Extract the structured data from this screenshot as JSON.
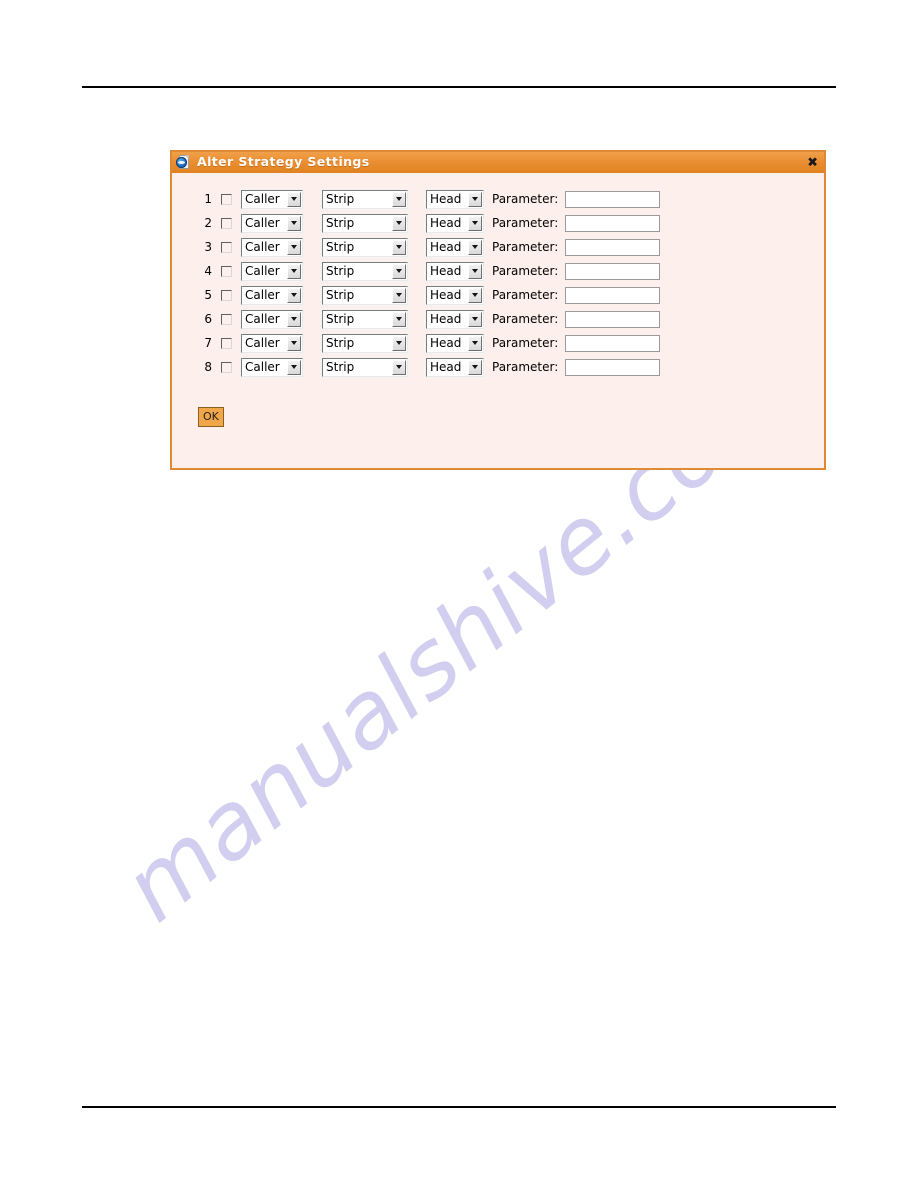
{
  "page": {
    "watermark": "manualshive.com",
    "rule_color": "#000000"
  },
  "dialog": {
    "title": "Alter Strategy Settings",
    "icon": "ie-page-icon",
    "close_label": "✖",
    "border_color": "#e08a36",
    "titlebar_color": "#eb8f33",
    "body_color": "#fdf0ec",
    "rows": [
      {
        "num": "1",
        "checked": false,
        "caller": "Caller",
        "strip": "Strip",
        "head": "Head",
        "param_label": "Parameter:",
        "param_value": ""
      },
      {
        "num": "2",
        "checked": false,
        "caller": "Caller",
        "strip": "Strip",
        "head": "Head",
        "param_label": "Parameter:",
        "param_value": ""
      },
      {
        "num": "3",
        "checked": false,
        "caller": "Caller",
        "strip": "Strip",
        "head": "Head",
        "param_label": "Parameter:",
        "param_value": ""
      },
      {
        "num": "4",
        "checked": false,
        "caller": "Caller",
        "strip": "Strip",
        "head": "Head",
        "param_label": "Parameter:",
        "param_value": ""
      },
      {
        "num": "5",
        "checked": false,
        "caller": "Caller",
        "strip": "Strip",
        "head": "Head",
        "param_label": "Parameter:",
        "param_value": ""
      },
      {
        "num": "6",
        "checked": false,
        "caller": "Caller",
        "strip": "Strip",
        "head": "Head",
        "param_label": "Parameter:",
        "param_value": ""
      },
      {
        "num": "7",
        "checked": false,
        "caller": "Caller",
        "strip": "Strip",
        "head": "Head",
        "param_label": "Parameter:",
        "param_value": ""
      },
      {
        "num": "8",
        "checked": false,
        "caller": "Caller",
        "strip": "Strip",
        "head": "Head",
        "param_label": "Parameter:",
        "param_value": ""
      }
    ],
    "ok_label": "OK"
  }
}
